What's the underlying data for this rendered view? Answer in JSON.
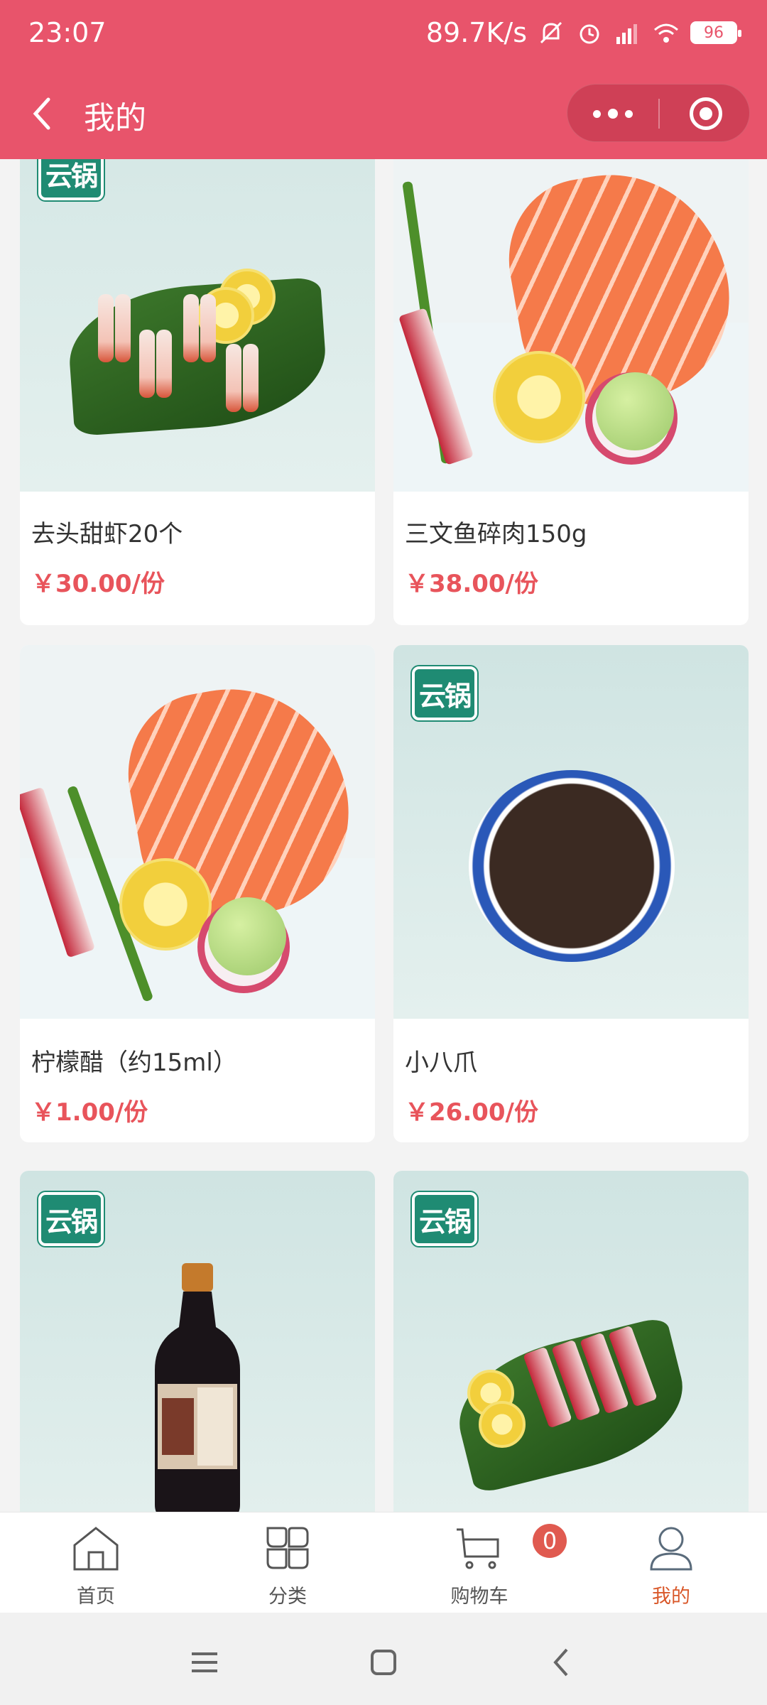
{
  "status_bar": {
    "time": "23:07",
    "net_speed": "89.7K/s",
    "battery": "96"
  },
  "nav": {
    "title": "我的"
  },
  "logo_text": "云锅",
  "products": [
    {
      "name": "去头甜虾20个",
      "price": "￥30.00/份"
    },
    {
      "name": "三文鱼碎肉150g",
      "price": "￥38.00/份"
    },
    {
      "name": "柠檬醋（约15ml）",
      "price": "￥1.00/份"
    },
    {
      "name": "小八爪",
      "price": "￥26.00/份"
    },
    {
      "name": "",
      "price": ""
    },
    {
      "name": "",
      "price": ""
    }
  ],
  "tabbar": {
    "home": "首页",
    "category": "分类",
    "cart": "购物车",
    "cart_count": "0",
    "mine": "我的"
  },
  "colors": {
    "header_bg": "#e8546b",
    "price": "#e8545b",
    "active_tab": "#d9582a",
    "logo": "#1f8b73"
  }
}
